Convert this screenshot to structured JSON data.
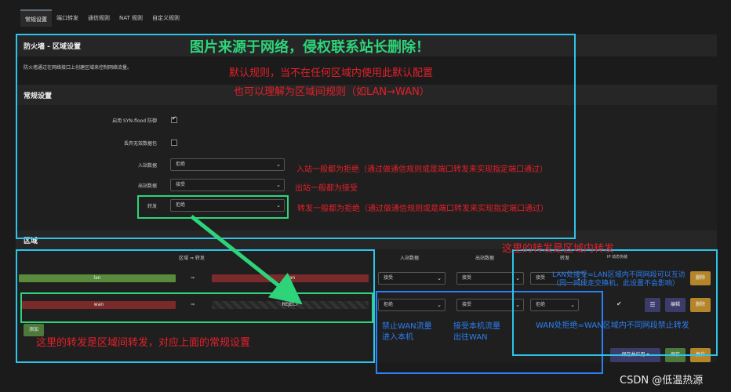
{
  "tabs": [
    "常规设置",
    "端口转发",
    "通信规则",
    "NAT 规则",
    "自定义规则"
  ],
  "firewall": {
    "title": "防火墙 - 区域设置",
    "description": "防火墙通过在网络接口上创建区域来控制网络流量。"
  },
  "general": {
    "title": "常规设置",
    "syn_flood_label": "启用 SYN-flood 防御",
    "drop_invalid_label": "丢弃无效数据包",
    "input_label": "入站数据",
    "input_value": "拒绝",
    "output_label": "出站数据",
    "output_value": "接受",
    "forward_label": "转发",
    "forward_value": "拒绝"
  },
  "zones": {
    "title": "区域",
    "header_zone_forward": "区域 ⇒ 转发",
    "header_input": "入站数据",
    "header_output": "出站数据",
    "header_forward": "转发",
    "header_masq": "IP 动态伪装",
    "arrow": "⇒",
    "rows": [
      {
        "zone": "lan",
        "target": "wan",
        "input": "接受",
        "output": "接受",
        "forward": "接受"
      },
      {
        "zone": "wan",
        "target": "REJECT",
        "input": "拒绝",
        "output": "接受",
        "forward": "拒绝"
      }
    ],
    "add_button": "添加",
    "menu_icon": "☰",
    "edit_button": "编辑",
    "delete_button": "删除"
  },
  "actions": {
    "save_apply": "保存并应用",
    "save": "保存",
    "reset": "复位"
  },
  "annotations": {
    "watermark_top": "图片来源于网络，侵权联系站长删除！",
    "default_rules": "默认规则，当不在任何区域内使用此默认配置",
    "inter_zone_rules": "也可以理解为区域间规则（如LAN→WAN）",
    "input_note": "入站一般都为拒绝（通过做通信规则或是端口转发来实现指定端口通过）",
    "output_note": "出站一般都为接受",
    "forward_note": "转发一般都为拒绝（通过做通信规则或是端口转发来实现指定端口通过）",
    "intra_zone_forward": "这里的转发是区域内转发",
    "lan_accept_1": "LAN处接受=LAN区域内不同网段可以互访",
    "lan_accept_2": "（同一网段走交换机，此设置不会影响）",
    "wan_reject": "WAN处拒绝=WAN区域内不同网段禁止转发",
    "block_wan_1": "禁止WAN流量",
    "block_wan_2": "进入本机",
    "accept_local_1": "接受本机流量",
    "accept_local_2": "出往WAN",
    "inter_zone_forward": "这里的转发是区域间转发，对应上面的常规设置",
    "csdn": "CSDN @低温热源"
  },
  "colors": {
    "lan_green": "#5a8a3c",
    "wan_red": "#7a2a2a",
    "accent_cyan": "#2ec4ea",
    "accent_green": "#2ed47a",
    "accent_blue": "#2c7ff5",
    "annotation_red": "#e4202a"
  }
}
